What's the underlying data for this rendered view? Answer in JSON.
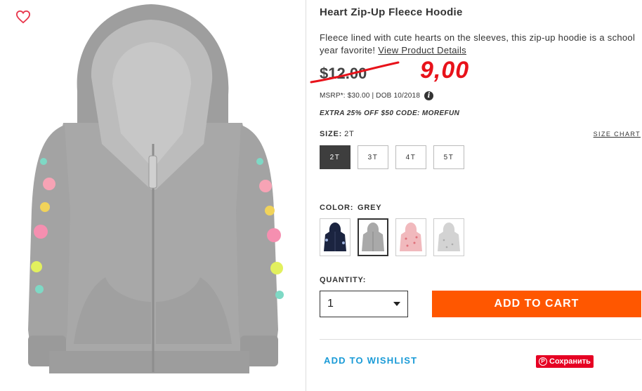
{
  "product": {
    "title": "Heart Zip-Up Fleece Hoodie",
    "description": "Fleece lined with cute hearts on the sleeves, this zip-up hoodie is a school year favorite!",
    "details_link": "View Product Details"
  },
  "price": {
    "original": "$12.00",
    "handwritten_new": "9,00",
    "msrp": "MSRP*: $30.00 | DOB 10/2018",
    "promo": "EXTRA 25% OFF $50 CODE: MOREFUN"
  },
  "size": {
    "label": "SIZE:",
    "selected": "2T",
    "chart_link": "SIZE CHART",
    "options": [
      "2T",
      "3T",
      "4T",
      "5T"
    ]
  },
  "color": {
    "label": "COLOR:",
    "selected": "GREY",
    "swatches": [
      {
        "name": "navy",
        "hex": "#1b2440"
      },
      {
        "name": "grey",
        "hex": "#a9a9a9"
      },
      {
        "name": "pink",
        "hex": "#f1b9bd"
      },
      {
        "name": "light-grey",
        "hex": "#d3d3d3"
      }
    ]
  },
  "quantity": {
    "label": "QUANTITY:",
    "value": "1"
  },
  "actions": {
    "add_to_cart": "ADD TO CART",
    "wishlist": "ADD TO WISHLIST",
    "pinterest_save": "Сохранить"
  },
  "colors": {
    "accent": "#ff5700",
    "link": "#1a9bd7",
    "handwriting": "#e8121a",
    "pinterest": "#e60023"
  }
}
